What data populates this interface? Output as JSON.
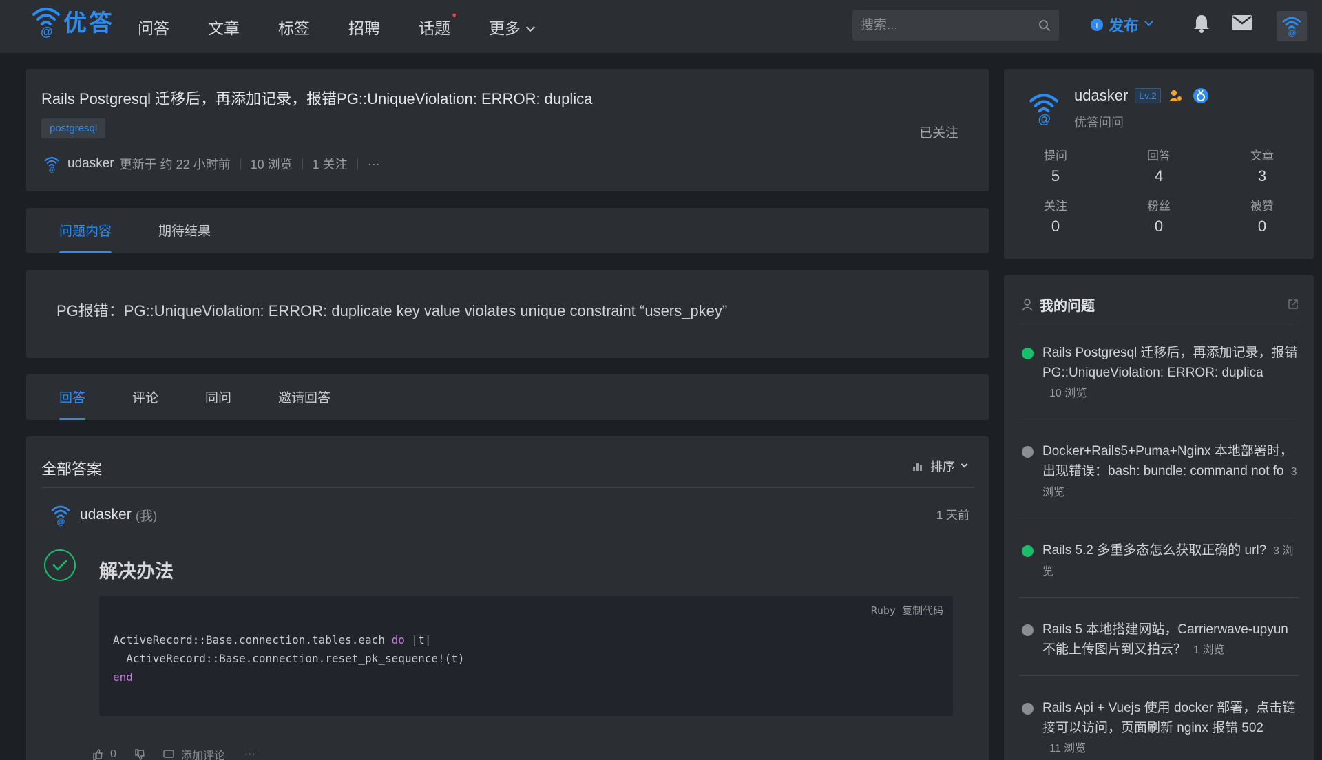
{
  "brand": {
    "name": "优答",
    "color": "#2d8cf0"
  },
  "nav": {
    "items": [
      {
        "label": "问答"
      },
      {
        "label": "文章"
      },
      {
        "label": "标签"
      },
      {
        "label": "招聘"
      },
      {
        "label": "话题"
      },
      {
        "label": "更多"
      }
    ],
    "search_placeholder": "搜索...",
    "publish_label": "发布"
  },
  "question": {
    "title": "Rails Postgresql 迁移后，再添加记录，报错PG::UniqueViolation: ERROR: duplica",
    "tag": "postgresql",
    "follow_status": "已关注",
    "author": "udasker",
    "updated": "更新于 约 22 小时前",
    "views": "10 浏览",
    "follows": "1 关注",
    "more": "···"
  },
  "content_tabs": [
    {
      "label": "问题内容"
    },
    {
      "label": "期待结果"
    }
  ],
  "content_body": "PG报错：PG::UniqueViolation: ERROR: duplicate key value violates unique constraint “users_pkey”",
  "answer_tabs": [
    {
      "label": "回答"
    },
    {
      "label": "评论"
    },
    {
      "label": "同问"
    },
    {
      "label": "邀请回答"
    }
  ],
  "answers": {
    "header": "全部答案",
    "sort_label": "排序",
    "item": {
      "user": "udasker",
      "me_label": "(我)",
      "time": "1 天前",
      "title": "解决办法",
      "code_lang": "Ruby  复制代码",
      "code": {
        "l1a": "ActiveRecord::Base.connection.tables.each ",
        "l1kw": "do",
        "l1b": " |t|",
        "l2": "  ActiveRecord::Base.connection.reset_pk_sequence!(t)",
        "l3kw": "end"
      },
      "likes": "0",
      "add_comment": "添加评论",
      "more": "···"
    }
  },
  "profile": {
    "name": "udasker",
    "level": "Lv.2",
    "subtitle": "优答问问",
    "stats": [
      {
        "label": "提问",
        "value": "5"
      },
      {
        "label": "回答",
        "value": "4"
      },
      {
        "label": "文章",
        "value": "3"
      },
      {
        "label": "关注",
        "value": "0"
      },
      {
        "label": "粉丝",
        "value": "0"
      },
      {
        "label": "被赞",
        "value": "0"
      }
    ]
  },
  "my_questions": {
    "title": "我的问题",
    "items": [
      {
        "title": "Rails Postgresql 迁移后，再添加记录，报错PG::UniqueViolation: ERROR: duplica",
        "views": "10 浏览",
        "status": "ok"
      },
      {
        "title": "Docker+Rails5+Puma+Nginx 本地部署时，出现错误：bash: bundle: command not fo",
        "views": "3 浏览",
        "status": "info"
      },
      {
        "title": "Rails 5.2 多重多态怎么获取正确的 url?",
        "views": "3 浏览",
        "status": "ok"
      },
      {
        "title": "Rails 5 本地搭建网站，Carrierwave-upyun 不能上传图片到又拍云？",
        "views": "1 浏览",
        "status": "info"
      },
      {
        "title": "Rails Api + Vuejs 使用 docker 部署，点击链接可以访问，页面刷新 nginx 报错 502",
        "views": "11 浏览",
        "status": "info"
      }
    ]
  }
}
